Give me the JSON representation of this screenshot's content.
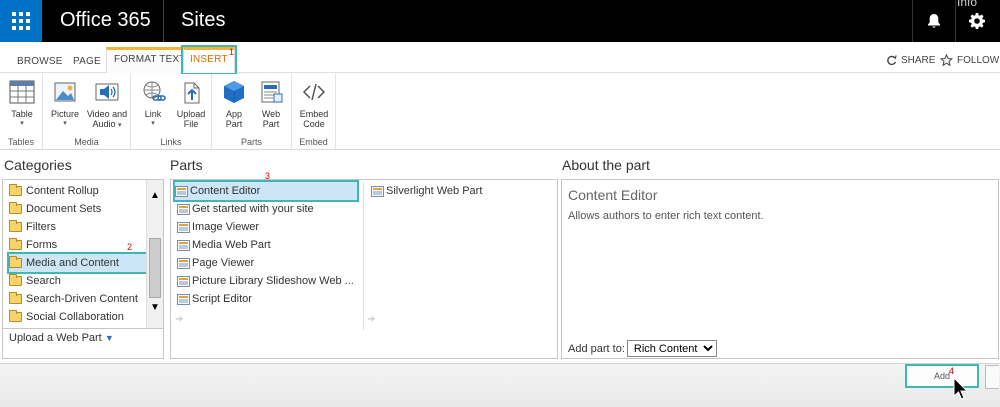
{
  "suite": {
    "brand": "Office 365",
    "title": "Sites",
    "info_text": "Info"
  },
  "tabs": {
    "browse": "BROWSE",
    "page": "PAGE",
    "format_text": "FORMAT TEXT",
    "insert": "INSERT",
    "share": "SHARE",
    "follow": "FOLLOW"
  },
  "annotations": {
    "n1": "1",
    "n2": "2",
    "n3": "3",
    "n4": "4"
  },
  "ribbon": {
    "groups": {
      "tables": "Tables",
      "media": "Media",
      "links": "Links",
      "parts": "Parts",
      "embed": "Embed"
    },
    "buttons": {
      "table": "Table",
      "picture": "Picture",
      "video_and_audio_1": "Video and",
      "video_and_audio_2": "Audio",
      "link": "Link",
      "upload_file_1": "Upload",
      "upload_file_2": "File",
      "app_part_1": "App",
      "app_part_2": "Part",
      "web_part_1": "Web",
      "web_part_2": "Part",
      "embed_code_1": "Embed",
      "embed_code_2": "Code"
    }
  },
  "categories": {
    "title": "Categories",
    "items": [
      "Content Rollup",
      "Document Sets",
      "Filters",
      "Forms",
      "Media and Content",
      "Search",
      "Search-Driven Content",
      "Social Collaboration"
    ],
    "selected": "Media and Content",
    "upload_label": "Upload a Web Part"
  },
  "parts": {
    "title": "Parts",
    "col1": [
      "Content Editor",
      "Get started with your site",
      "Image Viewer",
      "Media Web Part",
      "Page Viewer",
      "Picture Library Slideshow Web ...",
      "Script Editor"
    ],
    "col2": [
      "Silverlight Web Part"
    ],
    "selected": "Content Editor"
  },
  "about": {
    "title": "About the part",
    "part_name": "Content Editor",
    "description": "Allows authors to enter rich text content.",
    "add_part_to_label": "Add part to:",
    "add_part_to_value": "Rich Content"
  },
  "footer": {
    "add_label": "Add"
  },
  "colors": {
    "suite_bar": "#000000",
    "waffle": "#0072c6",
    "context_tab_accent": "#f3b33d",
    "active_tab_text": "#d86e00",
    "highlight_outline": "#3fb8b3",
    "selection": "#cde6f7"
  },
  "icons": [
    "waffle-icon",
    "bell-icon",
    "settings-gear-icon",
    "share-icon",
    "star-icon",
    "table-icon",
    "picture-icon",
    "video-audio-icon",
    "link-icon",
    "upload-file-icon",
    "app-part-icon",
    "web-part-icon",
    "embed-code-icon",
    "folder-icon",
    "web-part-item-icon",
    "scroll-up-arrow-icon",
    "scroll-down-arrow-icon",
    "mouse-pointer-icon"
  ]
}
